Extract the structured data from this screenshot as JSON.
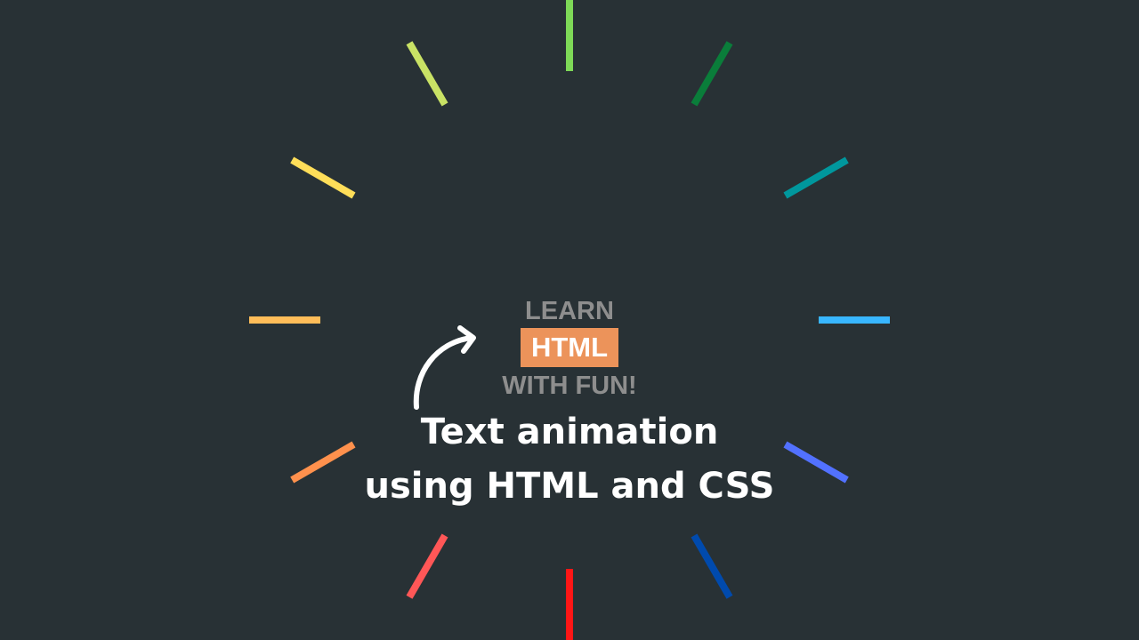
{
  "badge": {
    "line1": "LEARN",
    "highlight": "HTML",
    "line3": "WITH FUN!"
  },
  "headline": {
    "line1": "Text animation",
    "line2": "using HTML and CSS"
  },
  "colors": {
    "background": "#283135",
    "highlight": "#ec935a",
    "rays": [
      "#7ed957",
      "#0a7d3a",
      "#00979d",
      "#38b6ff",
      "#5271ff",
      "#004aad",
      "#ff1616",
      "#ff5757",
      "#ff914d",
      "#ffbd59",
      "#ffde59",
      "#c9e265"
    ]
  },
  "icons": {
    "arrow": "curved-arrow-icon"
  }
}
